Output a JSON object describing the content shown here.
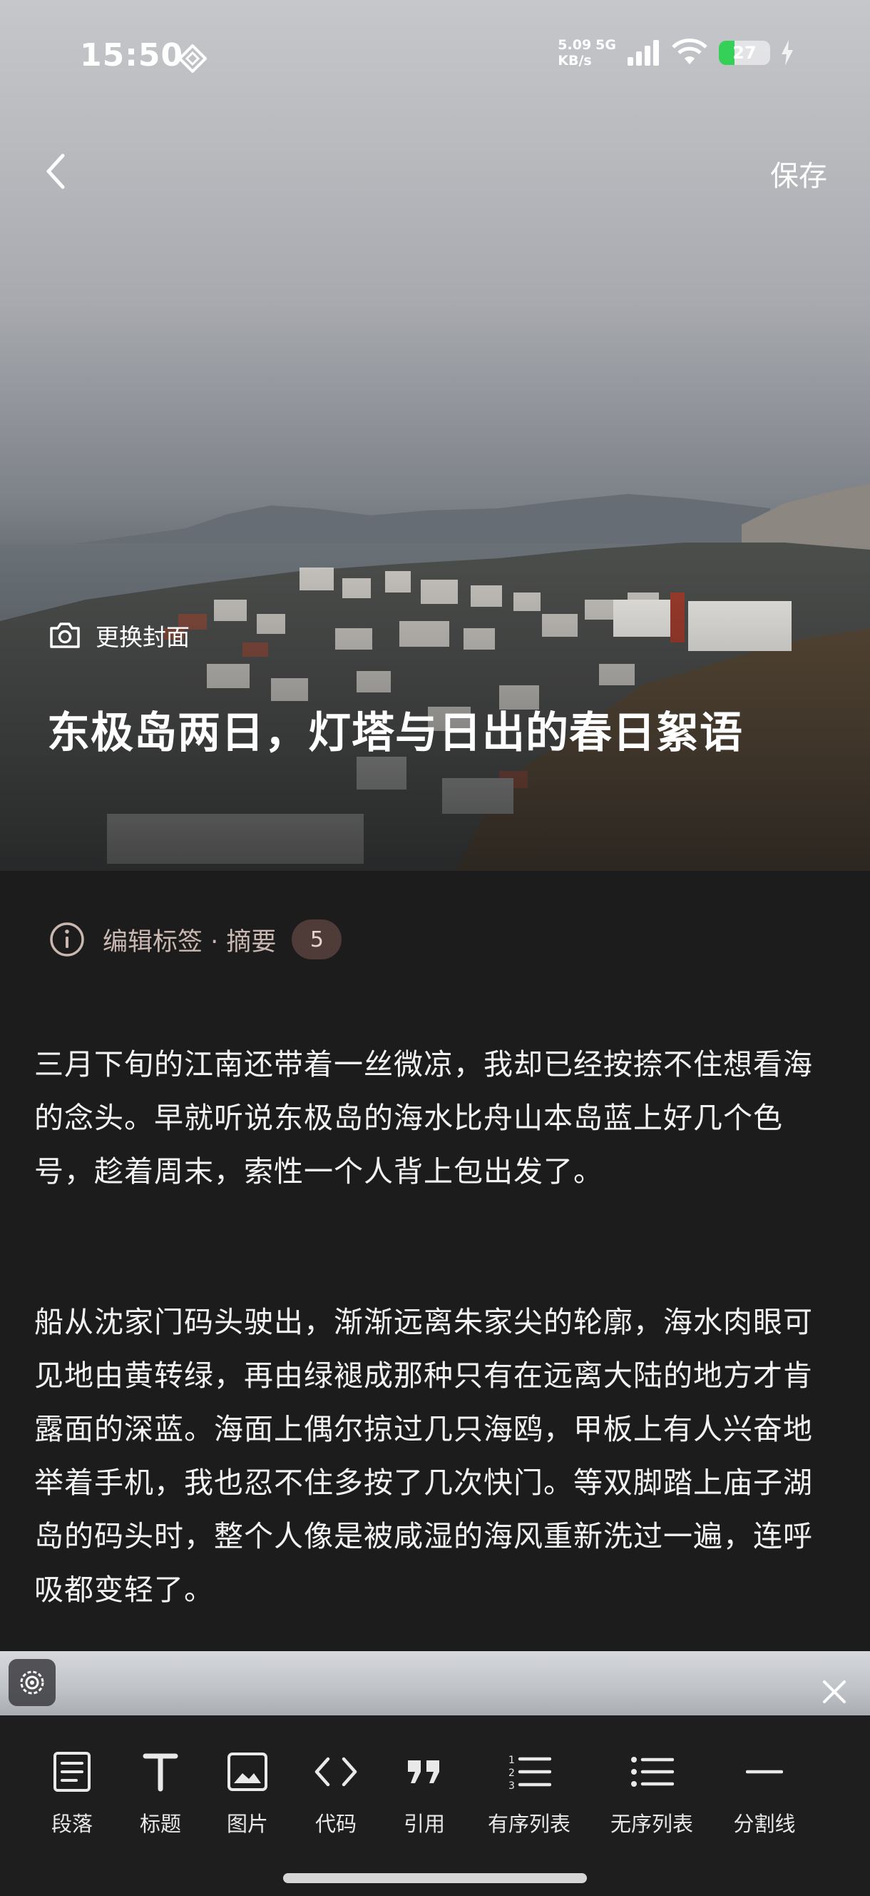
{
  "status_bar": {
    "time": "15:50",
    "net_speed_value": "5.09",
    "net_speed_unit": "KB/s",
    "network_type": "5G",
    "battery_level": "27"
  },
  "nav": {
    "save_label": "保存"
  },
  "cover": {
    "change_cover_label": "更换封面",
    "title": "东极岛两日，灯塔与日出的春日絮语"
  },
  "meta": {
    "tags_summary_label": "编辑标签 · 摘要",
    "tags_count": "5"
  },
  "body": {
    "paragraphs": [
      "三月下旬的江南还带着一丝微凉，我却已经按捺不住想看海的念头。早就听说东极岛的海水比舟山本岛蓝上好几个色号，趁着周末，索性一个人背上包出发了。",
      "船从沈家门码头驶出，渐渐远离朱家尖的轮廓，海水肉眼可见地由黄转绿，再由绿褪成那种只有在远离大陆的地方才肯露面的深蓝。海面上偶尔掠过几只海鸥，甲板上有人兴奋地举着手机，我也忍不住多按了几次快门。等双脚踏上庙子湖岛的码头时，整个人像是被咸湿的海风重新洗过一遍，连呼吸都变轻了。"
    ]
  },
  "toolbar": {
    "items": [
      {
        "label": "段落",
        "icon": "paragraph-icon"
      },
      {
        "label": "标题",
        "icon": "heading-icon"
      },
      {
        "label": "图片",
        "icon": "image-icon"
      },
      {
        "label": "代码",
        "icon": "code-icon"
      },
      {
        "label": "引用",
        "icon": "quote-icon"
      },
      {
        "label": "有序列表",
        "icon": "ordered-list-icon"
      },
      {
        "label": "无序列表",
        "icon": "unordered-list-icon"
      },
      {
        "label": "分割线",
        "icon": "divider-icon"
      }
    ]
  },
  "colors": {
    "background": "#1c1c1d",
    "toolbar_background": "#1e1e1e",
    "tag_label": "#c9b7b0",
    "tag_badge": "#4f3b38",
    "battery_green": "#35d058"
  }
}
